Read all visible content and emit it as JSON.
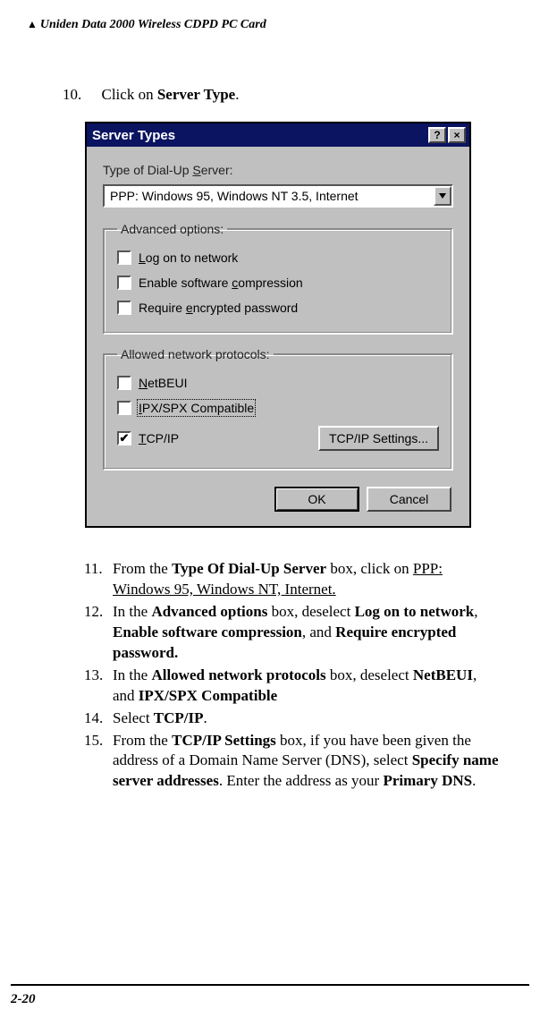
{
  "header": "Uniden Data 2000 Wireless CDPD PC Card",
  "step10": {
    "num": "10.",
    "prefix": "Click on ",
    "bold": "Server Type",
    "suffix": "."
  },
  "dialog": {
    "title": "Server Types",
    "help": "?",
    "close": "×",
    "typeLabel_pre": "Type of Dial-Up ",
    "typeLabel_u": "S",
    "typeLabel_post": "erver:",
    "combo_value": "PPP: Windows 95, Windows NT 3.5, Internet",
    "adv": {
      "legend": "Advanced options:",
      "log_u": "L",
      "log_post": "og on to network",
      "enable_pre": "Enable software ",
      "enable_u": "c",
      "enable_post": "ompression",
      "req_pre": "Require ",
      "req_u": "e",
      "req_post": "ncrypted password"
    },
    "proto": {
      "legend": "Allowed network protocols:",
      "net_u": "N",
      "net_post": "etBEUI",
      "ipx_u": "I",
      "ipx_post": "PX/SPX Compatible",
      "tcp_u": "T",
      "tcp_post": "CP/IP",
      "settings": "TCP/IP Settings..."
    },
    "ok": "OK",
    "cancel": "Cancel"
  },
  "steps": {
    "s11": {
      "num": "11.",
      "a": "From the ",
      "b": "Type Of Dial-Up Server",
      "c": " box, click on ",
      "d": "PPP: Windows 95, Windows NT, Internet."
    },
    "s12": {
      "num": "12.",
      "a": "In the ",
      "b": "Advanced options",
      "c": " box, deselect ",
      "d": "Log on to network",
      "e": ", ",
      "f": "Enable software compression",
      "g": ", and ",
      "h": "Require encrypted password."
    },
    "s13": {
      "num": "13.",
      "a": "In the ",
      "b": "Allowed network protocols",
      "c": " box, deselect ",
      "d": "NetBEUI",
      "e": ", and ",
      "f": "IPX/SPX Compatible"
    },
    "s14": {
      "num": "14.",
      "a": "Select ",
      "b": "TCP/IP",
      "c": "."
    },
    "s15": {
      "num": "15.",
      "a": "From the ",
      "b": "TCP/IP Settings",
      "c": " box, if you have been given the address of a Domain Name Server (DNS), select ",
      "d": "Specify name server addresses",
      "e": ".  Enter the address as your ",
      "f": "Primary DNS",
      "g": "."
    }
  },
  "footer": "2-20"
}
